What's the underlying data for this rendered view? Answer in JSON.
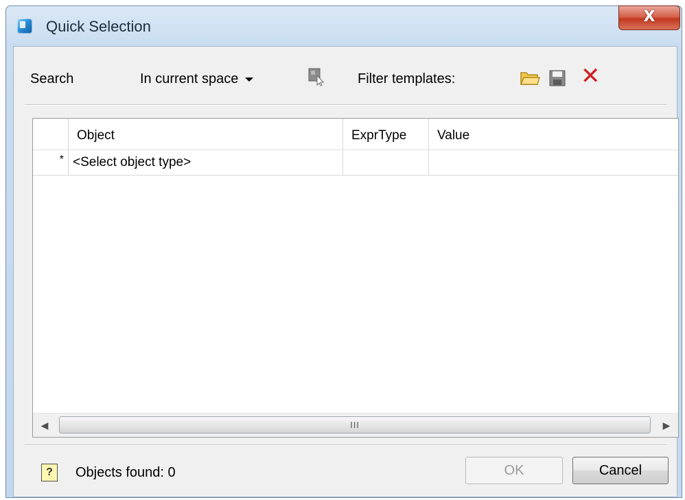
{
  "window": {
    "title": "Quick Selection",
    "close_label": "X"
  },
  "toolbar": {
    "search_label": "Search",
    "scope_value": "In current space",
    "filter_label": "Filter templates:"
  },
  "grid": {
    "columns": [
      "",
      "Object",
      "ExprType",
      "Value"
    ],
    "rows": [
      {
        "marker": "*",
        "object": "<Select object type>",
        "exprtype": "",
        "value": ""
      }
    ],
    "scroll_grip": "III"
  },
  "footer": {
    "help_glyph": "?",
    "objects_found": "Objects found: 0",
    "ok_label": "OK",
    "cancel_label": "Cancel"
  },
  "icons": {
    "app": "app-icon",
    "pick": "select-objects-icon",
    "open": "folder-icon",
    "save": "save-icon",
    "delete": "delete-icon",
    "help": "help-icon"
  },
  "colors": {
    "delete": "#d01f1f",
    "title_close": "#c2391f"
  }
}
